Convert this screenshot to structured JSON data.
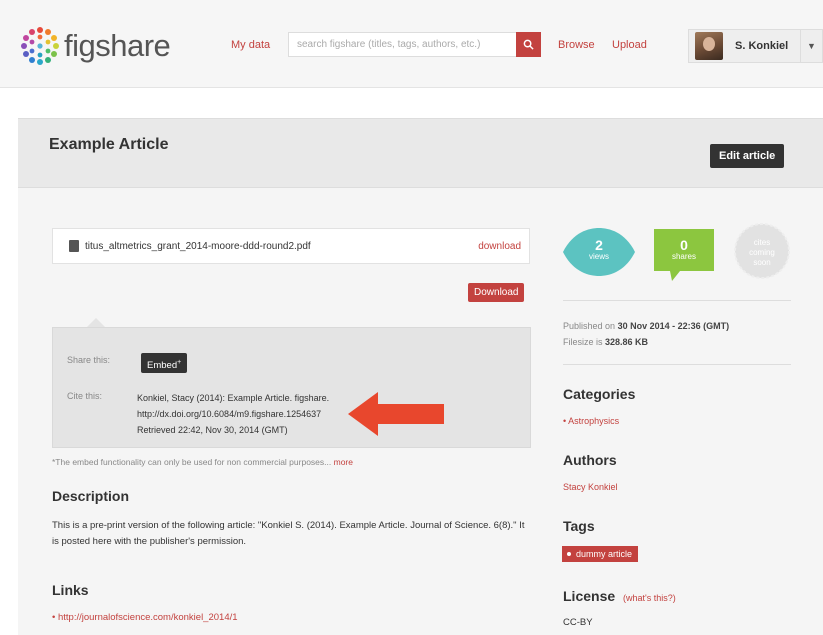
{
  "header": {
    "logo_text": "figshare",
    "nav_mydata": "My data",
    "search_placeholder": "search figshare (titles, tags, authors, etc.)",
    "nav_browse": "Browse",
    "nav_upload": "Upload",
    "user_name": "S. Konkiel",
    "user_caret": "▼"
  },
  "article": {
    "title": "Example Article",
    "edit_label": "Edit article",
    "file_name": "titus_altmetrics_grant_2014-moore-ddd-round2.pdf",
    "file_download_label": "download",
    "download_button_label": "Download"
  },
  "share": {
    "share_label": "Share this:",
    "embed_label": "Embed",
    "cite_label": "Cite this:",
    "cite_lines": [
      "Konkiel, Stacy (2014): Example Article. figshare.",
      "http://dx.doi.org/10.6084/m9.figshare.1254637",
      "Retrieved 22:42, Nov 30, 2014 (GMT)"
    ],
    "note": "*The embed functionality can only be used for non commercial purposes...",
    "note_more": "more"
  },
  "description": {
    "heading": "Description",
    "text": "This is a pre-print version of the following article: \"Konkiel S. (2014). Example Article. Journal of Science. 6(8).\" It is posted here with the publisher's permission."
  },
  "links": {
    "heading": "Links",
    "items": [
      "http://journalofscience.com/konkiel_2014/1"
    ]
  },
  "stats": {
    "views_count": "2",
    "views_label": "views",
    "shares_count": "0",
    "shares_label": "shares",
    "cites_label_1": "cites",
    "cites_label_2": "coming",
    "cites_label_3": "soon",
    "views_color": "#5cc3c1",
    "shares_color": "#8cc63f",
    "cites_color": "#e2e2e2"
  },
  "meta": {
    "published_prefix": "Published on",
    "published_date": "30 Nov 2014 - 22:36",
    "published_tz": "(GMT)",
    "filesize_prefix": "Filesize is",
    "filesize": "328.86 KB"
  },
  "categories": {
    "heading": "Categories",
    "items": [
      "Astrophysics"
    ]
  },
  "authors": {
    "heading": "Authors",
    "items": [
      "Stacy Konkiel"
    ]
  },
  "tags": {
    "heading": "Tags",
    "items": [
      "dummy article"
    ]
  },
  "license": {
    "heading": "License",
    "help": "(what's this?)",
    "value": "CC-BY"
  },
  "colors": {
    "accent": "#c3423f",
    "dark_button": "#333333"
  },
  "icons": [
    "figshare-logo-icon",
    "search-icon",
    "file-icon",
    "user-avatar",
    "red-arrow-icon"
  ]
}
